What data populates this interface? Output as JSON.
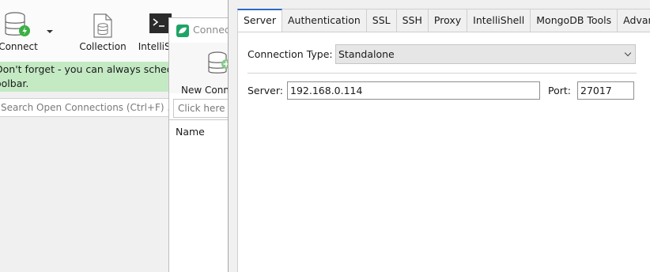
{
  "main_window": {
    "toolbar": {
      "connect_label": "Connect",
      "collection_label": "Collection",
      "intellishell_label": "IntelliSh"
    },
    "tip": {
      "line1": "Don't forget - you can always schedul",
      "line2": "oolbar."
    },
    "search_placeholder": "Search Open Connections (Ctrl+F) ..."
  },
  "connection_manager": {
    "title": "Connec",
    "new_connection_label": "New Conn",
    "quick_filter_placeholder": "Click here t",
    "list_header": "Name"
  },
  "settings_dialog": {
    "tabs": [
      {
        "label": "Server",
        "active": true
      },
      {
        "label": "Authentication",
        "active": false
      },
      {
        "label": "SSL",
        "active": false
      },
      {
        "label": "SSH",
        "active": false
      },
      {
        "label": "Proxy",
        "active": false
      },
      {
        "label": "IntelliShell",
        "active": false
      },
      {
        "label": "MongoDB Tools",
        "active": false
      },
      {
        "label": "Advanced",
        "active": false
      }
    ],
    "connection_type_label": "Connection Type:",
    "connection_type_value": "Standalone",
    "server_label": "Server:",
    "server_value": "192.168.0.114",
    "port_label": "Port:",
    "port_value": "27017"
  },
  "colors": {
    "tip_background": "#c4eac4",
    "tab_active_accent": "#2c6bc2",
    "app_icon": "#1fa463"
  }
}
